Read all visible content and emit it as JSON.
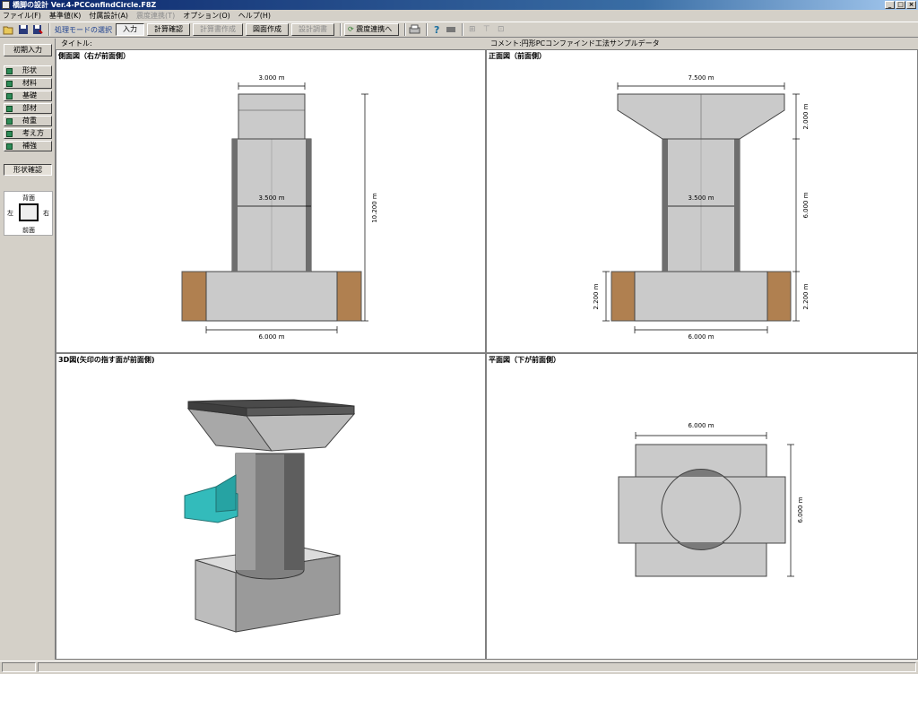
{
  "window": {
    "title": "橋脚の設計 Ver.4-PCConfindCircle.F8Z",
    "icon": "app-icon"
  },
  "menu": [
    {
      "label": "ファイル(F)",
      "enabled": true
    },
    {
      "label": "基準値(K)",
      "enabled": true
    },
    {
      "label": "付属設計(A)",
      "enabled": true
    },
    {
      "label": "震度連携(T)",
      "enabled": false
    },
    {
      "label": "オプション(O)",
      "enabled": true
    },
    {
      "label": "ヘルプ(H)",
      "enabled": true
    }
  ],
  "toolbar": {
    "mode_label": "処理モードの選択",
    "buttons": [
      {
        "label": "入力",
        "state": "active"
      },
      {
        "label": "計算確認",
        "state": "normal"
      },
      {
        "label": "計算書作成",
        "state": "disabled"
      },
      {
        "label": "図面作成",
        "state": "normal"
      },
      {
        "label": "設計調書",
        "state": "disabled"
      }
    ],
    "link_button": "震度連携へ",
    "icons": [
      "open-folder-icon",
      "save-icon",
      "save-as-icon",
      "print-icon",
      "help-icon",
      "gray-box-icon",
      "tool-a-icon",
      "tool-b-icon",
      "tool-c-icon"
    ]
  },
  "sidebar": {
    "title": "初期入力",
    "items": [
      "形状",
      "材料",
      "基礎",
      "部材",
      "荷重",
      "考え方",
      "補強"
    ],
    "tab": "形状確認",
    "orientation": {
      "top": "背面",
      "bottom": "前面",
      "left": "左",
      "right": "右"
    }
  },
  "info": {
    "title_label": "タイトル:",
    "comment_label": "コメント:円形PCコンファインド工法サンプルデータ"
  },
  "panes": {
    "side": {
      "title": "側面図（右が前面側）",
      "dims": {
        "top": "3.000 m",
        "mid": "3.500 m",
        "height": "10.200 m",
        "bottom": "6.000 m"
      }
    },
    "front": {
      "title": "正面図（前面側）",
      "dims": {
        "top": "7.500 m",
        "mid": "3.500 m",
        "right1": "2.000 m",
        "right2": "6.000 m",
        "right3": "2.200 m",
        "left": "2.200 m",
        "bottom": "6.000 m"
      }
    },
    "iso": {
      "title": "3D図(矢印の指す面が前面側)"
    },
    "plan": {
      "title": "平面図（下が前面側）",
      "dims": {
        "top": "6.000 m",
        "right": "6.000 m"
      }
    }
  },
  "colors": {
    "concrete": "#cacaca",
    "concrete_dark": "#6e6e6e",
    "soil": "#b08050",
    "arrow": "#33bbbb"
  }
}
